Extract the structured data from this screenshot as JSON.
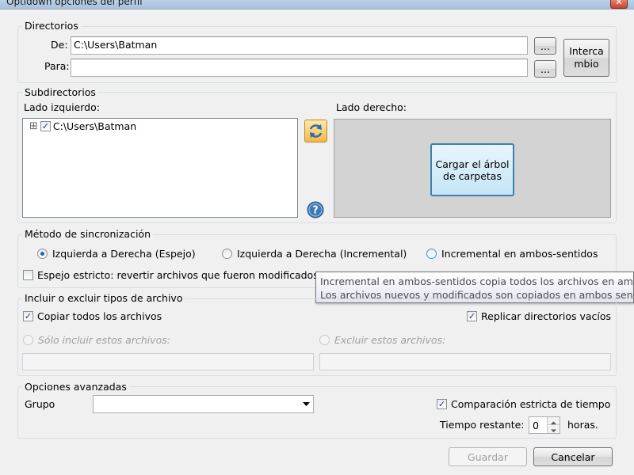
{
  "window": {
    "title": "Optidown opciones del perfil",
    "close_glyph": "✕"
  },
  "directorios": {
    "group_label": "Directorios",
    "de_label": "De:",
    "de_value": "C:\\Users\\Batman",
    "para_label": "Para:",
    "para_value": "",
    "browse_label": "...",
    "swap_label_line1": "Interca",
    "swap_label_line2": "mbio"
  },
  "subdirectorios": {
    "group_label": "Subdirectorios",
    "left_label": "Lado izquierdo:",
    "right_label": "Lado derecho:",
    "tree_root": "C:\\Users\\Batman",
    "tree_expander": "⊞",
    "load_tree_line1": "Cargar el árbol",
    "load_tree_line2": "de carpetas"
  },
  "sync": {
    "group_label": "Método de sincronización",
    "option_mirror": "Izquierda a Derecha (Espejo)",
    "option_incremental": "Izquierda a Derecha (Incremental)",
    "option_both": "Incremental en ambos-sentidos",
    "selected": "Izquierda a Derecha (Espejo)",
    "strict_mirror": "Espejo estricto: revertir archivos que fueron modificados",
    "strict_mirror_trailing": "... ...",
    "tooltip_line1": "Incremental en ambos-sentidos copia todos los archivos en ambos se",
    "tooltip_line2": "Los archivos nuevos y modificados son copiados en ambos sentidos,"
  },
  "include": {
    "group_label": "Incluir o excluir tipos de archivo",
    "copy_all": "Copiar todos los archivos",
    "copy_all_checked": true,
    "replicate_dirs": "Replicar directorios vacíos",
    "replicate_dirs_checked": true,
    "only_include": "Sólo incluir estos archivos:",
    "exclude": "Excluir estos archivos:"
  },
  "advanced": {
    "group_label": "Opciones avanzadas",
    "grupo_label": "Grupo",
    "grupo_value": "",
    "strict_time": "Comparación estricta de tiempo",
    "strict_time_checked": true,
    "time_label": "Tiempo restante:",
    "time_value": "0",
    "time_unit": "horas."
  },
  "buttons": {
    "save": "Guardar",
    "cancel": "Cancelar"
  },
  "check_glyph": "✓",
  "icons": {
    "refresh": "refresh-icon",
    "help": "help-icon",
    "dropdown": "dropdown-arrow-icon"
  }
}
